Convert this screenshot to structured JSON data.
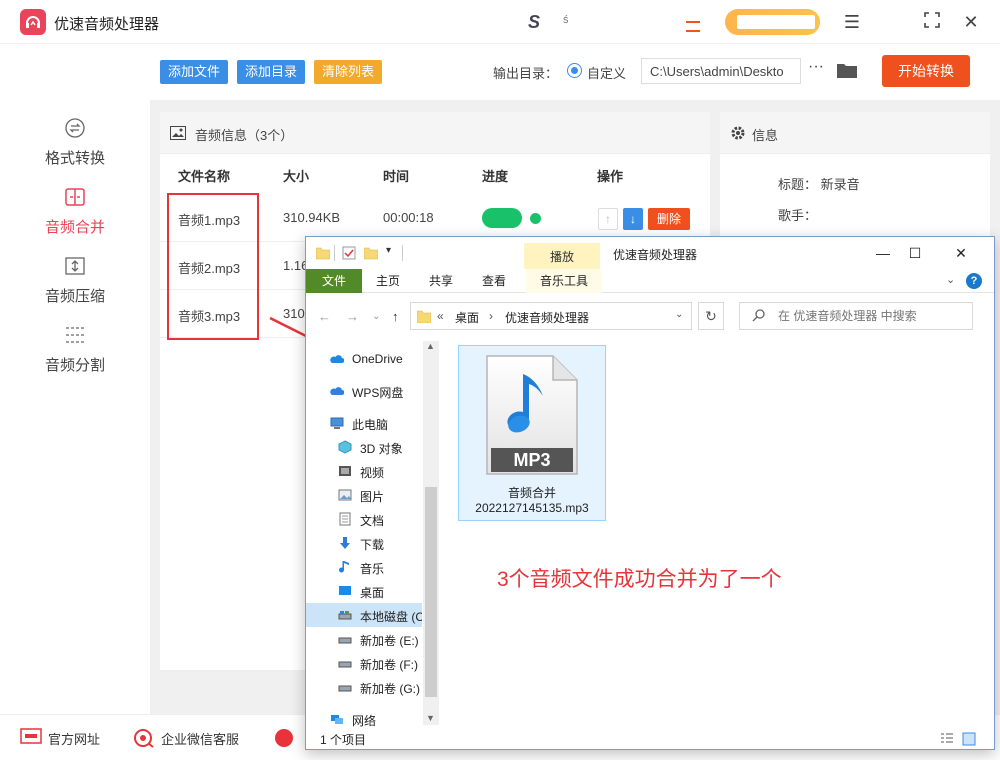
{
  "app": {
    "title": "优速音频处理器",
    "brand": "S",
    "brand_sub": "ś"
  },
  "sidebar": {
    "items": [
      {
        "label": "格式转换",
        "icon": "format-convert-icon"
      },
      {
        "label": "音频合并",
        "icon": "audio-merge-icon",
        "active": true
      },
      {
        "label": "音频压缩",
        "icon": "audio-compress-icon"
      },
      {
        "label": "音频分割",
        "icon": "audio-split-icon"
      }
    ]
  },
  "toolbar": {
    "add_file": "添加文件",
    "add_dir": "添加目录",
    "clear_list": "清除列表",
    "output_label": "输出目录：",
    "custom_label": "自定义",
    "output_path": "C:\\Users\\admin\\Deskto",
    "more": "···",
    "start": "开始转换"
  },
  "file_panel": {
    "title": "音频信息（3个）",
    "columns": [
      "文件名称",
      "大小",
      "时间",
      "进度",
      "操作"
    ],
    "rows": [
      {
        "name": "音频1.mp3",
        "size": "310.94KB",
        "time": "00:00:18"
      },
      {
        "name": "音频2.mp3",
        "size": "1.16"
      },
      {
        "name": "音频3.mp3",
        "size": "310"
      }
    ],
    "delete_label": "删除",
    "up_glyph": "↑",
    "down_glyph": "↓"
  },
  "info_panel": {
    "title": "信息",
    "title_label": "标题：",
    "title_value": "新录音",
    "artist_label": "歌手："
  },
  "footer": {
    "website": "官方网址",
    "wechat": "企业微信客服",
    "third": "Q"
  },
  "explorer": {
    "play_tab": "播放",
    "title": "优速音频处理器",
    "tabs": {
      "file": "文件",
      "home": "主页",
      "share": "共享",
      "view": "查看",
      "music_tools": "音乐工具"
    },
    "breadcrumb": {
      "prefix": "«",
      "desktop": "桌面",
      "sep": "›",
      "folder": "优速音频处理器"
    },
    "search_placeholder": "在 优速音频处理器 中搜索",
    "nav": [
      {
        "label": "OneDrive",
        "icon": "onedrive-icon"
      },
      {
        "label": "WPS网盘",
        "icon": "wps-cloud-icon"
      },
      {
        "label": "此电脑",
        "icon": "this-pc-icon"
      },
      {
        "label": "3D 对象",
        "icon": "3d-objects-icon"
      },
      {
        "label": "视频",
        "icon": "video-folder-icon"
      },
      {
        "label": "图片",
        "icon": "pictures-folder-icon"
      },
      {
        "label": "文档",
        "icon": "documents-folder-icon"
      },
      {
        "label": "下载",
        "icon": "downloads-folder-icon"
      },
      {
        "label": "音乐",
        "icon": "music-folder-icon"
      },
      {
        "label": "桌面",
        "icon": "desktop-folder-icon"
      },
      {
        "label": "本地磁盘 (C",
        "icon": "local-disk-icon",
        "selected": true
      },
      {
        "label": "新加卷 (E:)",
        "icon": "drive-icon"
      },
      {
        "label": "新加卷 (F:)",
        "icon": "drive-icon"
      },
      {
        "label": "新加卷 (G:)",
        "icon": "drive-icon"
      },
      {
        "label": "网络",
        "icon": "network-icon"
      }
    ],
    "file": {
      "badge": "MP3",
      "name_line1": "音频合并",
      "name_line2": "2022127145135.mp3"
    },
    "status": "1 个项目"
  },
  "annotation": "3个音频文件成功合并为了一个",
  "colors": {
    "accent_red": "#e9445a",
    "button_blue": "#3a8ee6",
    "button_yellow": "#f2a92c",
    "start_orange": "#f0501e",
    "progress_green": "#19c26a",
    "annotation_red": "#e8333a"
  }
}
